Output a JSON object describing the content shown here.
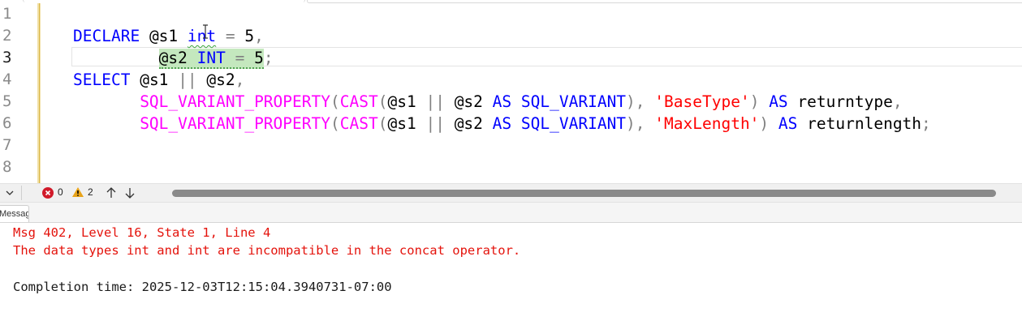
{
  "editor": {
    "line_numbers": [
      "1",
      "2",
      "3",
      "4",
      "5",
      "6",
      "7",
      "8"
    ],
    "active_line": "3",
    "lines": {
      "l2": {
        "declare": "DECLARE",
        "s1": "@s1",
        "int": "int",
        "eq": "=",
        "five": "5",
        "comma": ","
      },
      "l3": {
        "s2": "@s2",
        "int": "INT",
        "eq": "=",
        "five": "5",
        "semi": ";"
      },
      "l4": {
        "select": "SELECT",
        "s1": "@s1",
        "concat": "||",
        "s2": "@s2",
        "comma": ","
      },
      "l5": {
        "fn": "SQL_VARIANT_PROPERTY",
        "paren_open": "(",
        "cast": "CAST",
        "paren2": "(",
        "s1": "@s1",
        "concat": "||",
        "s2": "@s2",
        "as1": "AS",
        "type": "SQL_VARIANT",
        "close_comma": "),",
        "prop": "'BaseType'",
        "close": ")",
        "as2": "AS",
        "alias": "returntype",
        "comma": ","
      },
      "l6": {
        "fn": "SQL_VARIANT_PROPERTY",
        "paren_open": "(",
        "cast": "CAST",
        "paren2": "(",
        "s1": "@s1",
        "concat": "||",
        "s2": "@s2",
        "as1": "AS",
        "type": "SQL_VARIANT",
        "close_comma": "),",
        "prop": "'MaxLength'",
        "close": ")",
        "as2": "AS",
        "alias": "returnlength",
        "semi": ";"
      }
    }
  },
  "status": {
    "errors": "0",
    "warnings": "2"
  },
  "results": {
    "tab_label": "Messages",
    "messages": [
      "Msg 402, Level 16, State 1, Line 4",
      "The data types int and int are incompatible in the concat operator."
    ],
    "completion": "Completion time: 2025-12-03T12:15:04.3940731-07:00"
  },
  "colors": {
    "keyword": "#0000ff",
    "function": "#ff00ff",
    "string": "#ff0000",
    "operator": "#808080",
    "error_text": "#e4130c"
  }
}
